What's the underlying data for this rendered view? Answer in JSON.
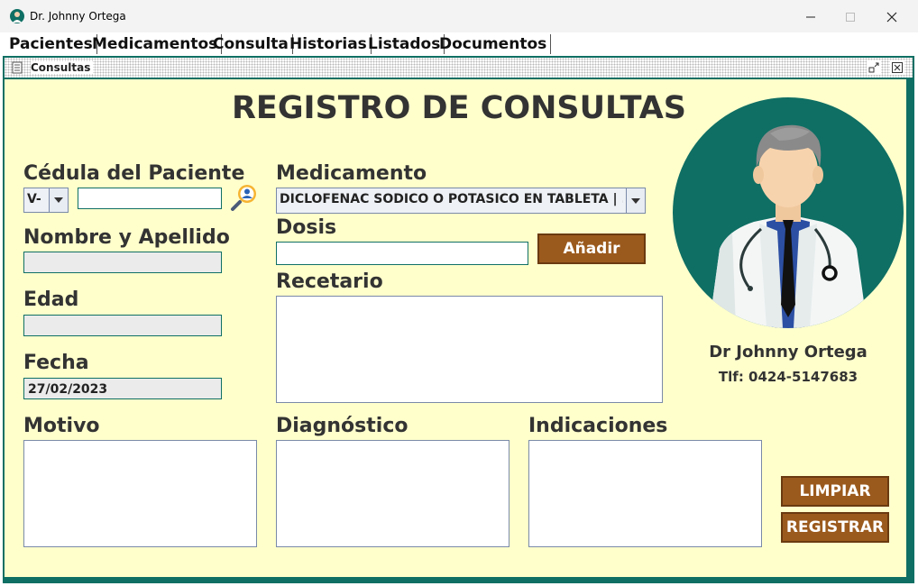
{
  "window": {
    "title": "Dr. Johnny Ortega"
  },
  "menu": [
    "Pacientes",
    "Medicamentos",
    "Consulta",
    "Historias",
    "Listados",
    "Documentos"
  ],
  "internal_frame": {
    "title": "Consultas"
  },
  "form": {
    "heading": "REGISTRO DE CONSULTAS",
    "cedula_label": "Cédula del Paciente",
    "cedula_prefix": "V-",
    "cedula_value": "",
    "nombre_label": "Nombre y Apellido",
    "nombre_value": "",
    "edad_label": "Edad",
    "edad_value": "",
    "fecha_label": "Fecha",
    "fecha_value": "27/02/2023",
    "medicamento_label": "Medicamento",
    "medicamento_value": "DICLOFENAC SODICO O POTASICO EN TABLETA | ...",
    "dosis_label": "Dosis",
    "dosis_value": "",
    "anadir_label": "Añadir",
    "recetario_label": "Recetario",
    "motivo_label": "Motivo",
    "diagnostico_label": "Diagnóstico",
    "indicaciones_label": "Indicaciones",
    "limpiar_label": "LIMPIAR",
    "registrar_label": "REGISTRAR"
  },
  "doctor": {
    "name": "Dr Johnny Ortega",
    "phone": "Tlf: 0424-5147683"
  },
  "colors": {
    "teal": "#0f6f64",
    "panel": "#ffffcc",
    "button": "#9b5a1d"
  }
}
